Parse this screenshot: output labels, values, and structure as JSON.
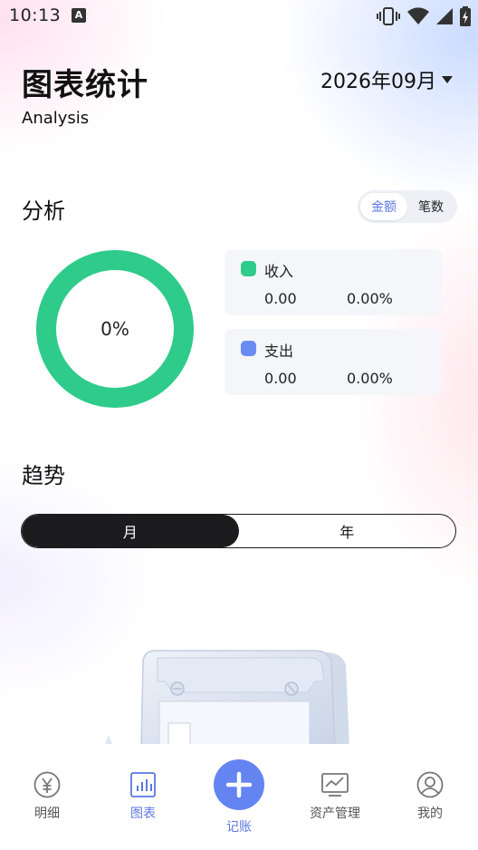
{
  "status_bar": {
    "time": "10:13",
    "notification_icon": "A"
  },
  "header": {
    "title": "图表统计",
    "subtitle": "Analysis",
    "month": "2026年09月"
  },
  "analysis": {
    "title": "分析",
    "toggle": [
      "金额",
      "笔数"
    ],
    "toggle_selected": "金额",
    "donut_label": "0%",
    "donut_color": "#2ecb8a",
    "stats": [
      {
        "name": "收入",
        "amount": "0.00",
        "percent": "0.00%",
        "color": "#2ecb8a"
      },
      {
        "name": "支出",
        "amount": "0.00",
        "percent": "0.00%",
        "color": "#6a8bf2"
      }
    ]
  },
  "trend": {
    "title": "趋势",
    "periods": [
      "月",
      "年"
    ],
    "period_selected": "月"
  },
  "bottom_nav": {
    "items": [
      {
        "label": "明细",
        "icon": "yen-circle-icon"
      },
      {
        "label": "图表",
        "icon": "bar-chart-icon",
        "active": true
      },
      {
        "label": "记账",
        "icon": "plus-icon"
      },
      {
        "label": "资产管理",
        "icon": "line-chart-monitor-icon"
      },
      {
        "label": "我的",
        "icon": "user-profile-icon"
      }
    ]
  },
  "colors": {
    "accent": "#6384f1",
    "income": "#2ecb8a",
    "expense": "#6a8bf2",
    "dark_toggle": "#1c1c1e"
  }
}
